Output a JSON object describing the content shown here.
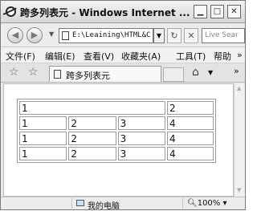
{
  "window": {
    "title": "跨多列表元 - Windows Internet ...",
    "minimize": "▁",
    "maximize": "□",
    "close": "✕"
  },
  "address": {
    "url": "E:\\Leaining\\HTML&C",
    "refresh": "↻",
    "stop": "✕",
    "search_placeholder": "Live Sear"
  },
  "menu": {
    "items": [
      "文件(F)",
      "编辑(E)",
      "查看(V)",
      "收藏夹(A)",
      "工具(T)",
      "帮助"
    ],
    "overflow": "»"
  },
  "tabbar": {
    "tab_label": "跨多列表元",
    "overflow": "»"
  },
  "table": {
    "rows": [
      [
        "1",
        "2"
      ],
      [
        "1",
        "2",
        "3",
        "4"
      ],
      [
        "1",
        "2",
        "3",
        "4"
      ],
      [
        "1",
        "2",
        "3",
        "4"
      ]
    ]
  },
  "status": {
    "zone": "我的电脑",
    "zoom": "100%"
  }
}
